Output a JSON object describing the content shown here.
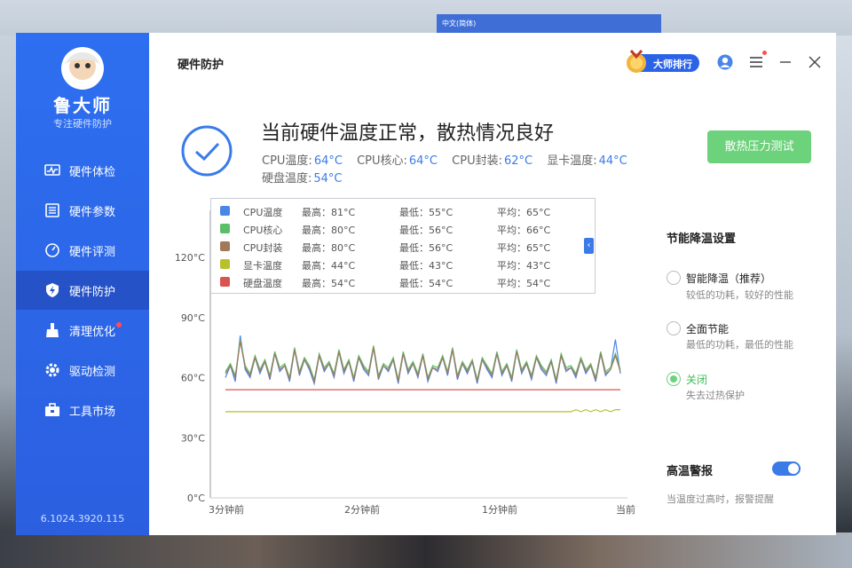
{
  "background": {
    "monitor_label": "中文(简体)"
  },
  "sidebar": {
    "brand": "鲁大师",
    "tagline": "专注硬件防护",
    "items": [
      {
        "label": "硬件体检",
        "icon": "pulse-monitor-icon"
      },
      {
        "label": "硬件参数",
        "icon": "list-icon"
      },
      {
        "label": "硬件评测",
        "icon": "speedometer-icon"
      },
      {
        "label": "硬件防护",
        "icon": "shield-bolt-icon",
        "active": true
      },
      {
        "label": "清理优化",
        "icon": "broom-icon",
        "badge": true
      },
      {
        "label": "驱动检测",
        "icon": "gear-icon"
      },
      {
        "label": "工具市场",
        "icon": "toolbox-icon"
      }
    ],
    "version": "6.1024.3920.115"
  },
  "header": {
    "title": "硬件防护",
    "rank_label": "大师排行"
  },
  "status": {
    "headline": "当前硬件温度正常，散热情况良好",
    "temps": [
      {
        "label": "CPU温度:",
        "value": "64°C"
      },
      {
        "label": "CPU核心:",
        "value": "64°C"
      },
      {
        "label": "CPU封装:",
        "value": "62°C"
      },
      {
        "label": "显卡温度:",
        "value": "44°C"
      },
      {
        "label": "硬盘温度:",
        "value": "54°C"
      }
    ],
    "stress_button": "散热压力测试"
  },
  "legend": [
    {
      "name": "CPU温度",
      "max": "最高：81°C",
      "min": "最低：55°C",
      "avg": "平均：65°C",
      "color": "#4a86e8"
    },
    {
      "name": "CPU核心",
      "max": "最高：80°C",
      "min": "最低：56°C",
      "avg": "平均：66°C",
      "color": "#5bbf6a"
    },
    {
      "name": "CPU封装",
      "max": "最高：80°C",
      "min": "最低：56°C",
      "avg": "平均：65°C",
      "color": "#a0785a"
    },
    {
      "name": "显卡温度",
      "max": "最高：44°C",
      "min": "最低：43°C",
      "avg": "平均：43°C",
      "color": "#b5c22a"
    },
    {
      "name": "硬盘温度",
      "max": "最高：54°C",
      "min": "最低：54°C",
      "avg": "平均：54°C",
      "color": "#d9534f"
    }
  ],
  "chart_data": {
    "type": "line",
    "x_ticks": [
      "3分钟前",
      "2分钟前",
      "1分钟前",
      "当前"
    ],
    "y_ticks": [
      "0°C",
      "30°C",
      "60°C",
      "90°C",
      "120°C"
    ],
    "ylim": [
      0,
      120
    ],
    "series": [
      {
        "name": "CPU温度",
        "color": "#4a86e8",
        "values": [
          60,
          66,
          58,
          81,
          64,
          60,
          70,
          62,
          68,
          59,
          72,
          63,
          66,
          58,
          74,
          61,
          69,
          64,
          57,
          71,
          63,
          67,
          60,
          73,
          62,
          68,
          58,
          70,
          64,
          61,
          75,
          59,
          66,
          63,
          69,
          57,
          72,
          62,
          67,
          60,
          71,
          58,
          65,
          63,
          70,
          61,
          74,
          59,
          67,
          62,
          68,
          57,
          69,
          64,
          60,
          72,
          61,
          66,
          58,
          73,
          62,
          67,
          59,
          70,
          64,
          61,
          68,
          57,
          71,
          63,
          65,
          60,
          69,
          62,
          66,
          58,
          72,
          61,
          64,
          79,
          62
        ]
      },
      {
        "name": "CPU核心",
        "color": "#5bbf6a",
        "values": [
          63,
          67,
          61,
          79,
          66,
          62,
          71,
          64,
          69,
          61,
          73,
          65,
          67,
          60,
          75,
          63,
          70,
          66,
          59,
          72,
          65,
          68,
          62,
          74,
          64,
          69,
          60,
          71,
          66,
          63,
          76,
          61,
          67,
          65,
          70,
          59,
          73,
          64,
          68,
          62,
          72,
          60,
          66,
          65,
          71,
          63,
          75,
          61,
          68,
          64,
          69,
          59,
          70,
          66,
          62,
          73,
          63,
          67,
          60,
          74,
          64,
          68,
          61,
          71,
          66,
          63,
          69,
          59,
          72,
          65,
          66,
          62,
          70,
          64,
          67,
          60,
          73,
          63,
          65,
          72,
          64
        ]
      },
      {
        "name": "CPU封装",
        "color": "#a0785a",
        "values": [
          62,
          66,
          60,
          78,
          65,
          61,
          70,
          63,
          68,
          60,
          72,
          64,
          66,
          59,
          74,
          62,
          69,
          65,
          58,
          71,
          64,
          67,
          61,
          73,
          63,
          68,
          59,
          70,
          65,
          62,
          75,
          60,
          66,
          64,
          69,
          58,
          72,
          63,
          67,
          61,
          71,
          59,
          65,
          64,
          70,
          62,
          74,
          60,
          67,
          63,
          68,
          58,
          69,
          65,
          61,
          72,
          62,
          66,
          59,
          73,
          63,
          67,
          60,
          70,
          65,
          62,
          68,
          58,
          71,
          64,
          65,
          61,
          69,
          63,
          66,
          59,
          72,
          62,
          64,
          71,
          63
        ]
      },
      {
        "name": "显卡温度",
        "color": "#b5c22a",
        "values": [
          43,
          43,
          43,
          43,
          43,
          43,
          43,
          43,
          43,
          43,
          43,
          43,
          43,
          43,
          43,
          43,
          43,
          43,
          43,
          43,
          43,
          43,
          43,
          43,
          43,
          43,
          43,
          43,
          43,
          43,
          43,
          43,
          43,
          43,
          43,
          43,
          43,
          43,
          43,
          43,
          43,
          43,
          43,
          43,
          43,
          43,
          43,
          43,
          43,
          43,
          43,
          43,
          43,
          43,
          43,
          43,
          43,
          43,
          43,
          43,
          43,
          43,
          43,
          43,
          43,
          43,
          43,
          43,
          43,
          43,
          43,
          44,
          43,
          44,
          43,
          44,
          43,
          44,
          43,
          44,
          44
        ]
      },
      {
        "name": "硬盘温度",
        "color": "#d9534f",
        "values": [
          54,
          54,
          54,
          54,
          54,
          54,
          54,
          54,
          54,
          54,
          54,
          54,
          54,
          54,
          54,
          54,
          54,
          54,
          54,
          54,
          54,
          54,
          54,
          54,
          54,
          54,
          54,
          54,
          54,
          54,
          54,
          54,
          54,
          54,
          54,
          54,
          54,
          54,
          54,
          54,
          54,
          54,
          54,
          54,
          54,
          54,
          54,
          54,
          54,
          54,
          54,
          54,
          54,
          54,
          54,
          54,
          54,
          54,
          54,
          54,
          54,
          54,
          54,
          54,
          54,
          54,
          54,
          54,
          54,
          54,
          54,
          54,
          54,
          54,
          54,
          54,
          54,
          54,
          54,
          54,
          54
        ]
      }
    ]
  },
  "settings": {
    "title": "节能降温设置",
    "options": [
      {
        "title": "智能降温（推荐）",
        "desc": "较低的功耗，较好的性能",
        "checked": false
      },
      {
        "title": "全面节能",
        "desc": "最低的功耗，最低的性能",
        "checked": false
      },
      {
        "title": "关闭",
        "desc": "失去过热保护",
        "checked": true
      }
    ],
    "alarm_title": "高温警报",
    "alarm_desc": "当温度过高时，报警提醒",
    "alarm_on": true
  }
}
